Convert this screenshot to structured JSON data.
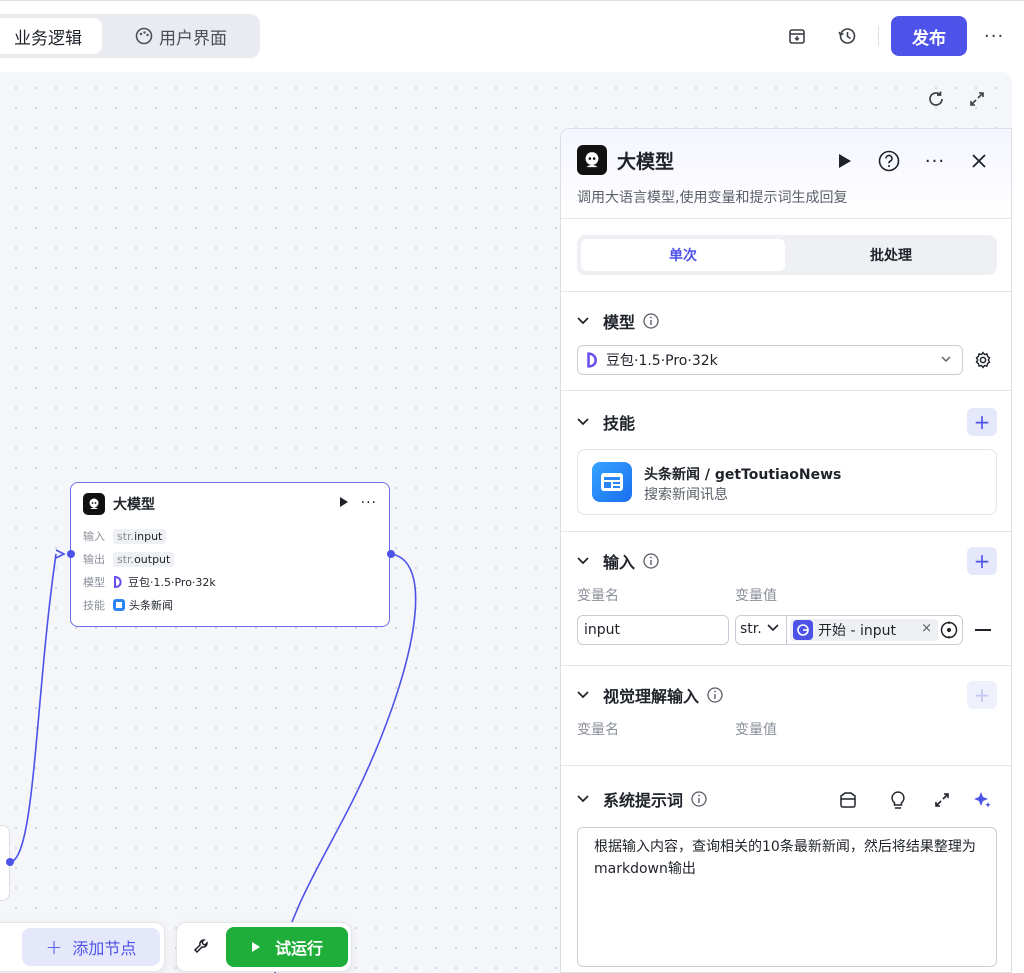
{
  "tabs": [
    {
      "label": "业务逻辑"
    },
    {
      "label": "用户界面"
    }
  ],
  "toolbar": {
    "publish_label": "发布"
  },
  "node": {
    "title": "大模型",
    "rows": [
      {
        "key": "输入",
        "prefix": "str.",
        "value": "input"
      },
      {
        "key": "输出",
        "prefix": "str.",
        "value": "output"
      },
      {
        "key": "模型",
        "value": "豆包·1.5·Pro·32k"
      },
      {
        "key": "技能",
        "value": "头条新闻"
      }
    ]
  },
  "bottom": {
    "add_node_label": "添加节点",
    "trial_label": "试运行"
  },
  "panel": {
    "title": "大模型",
    "description": "调用大语言模型,使用变量和提示词生成回复",
    "segments": [
      "单次",
      "批处理"
    ],
    "model_section": {
      "title": "模型",
      "selected": "豆包·1.5·Pro·32k"
    },
    "skill_section": {
      "title": "技能",
      "skill_name": "头条新闻 / getToutiaoNews",
      "skill_desc": "搜索新闻讯息"
    },
    "input_section": {
      "title": "输入",
      "col_name": "变量名",
      "col_value": "变量值",
      "var_name": "input",
      "var_type": "str.",
      "ref_label": "开始 - input"
    },
    "vision_section": {
      "title": "视觉理解输入",
      "col_name": "变量名",
      "col_value": "变量值"
    },
    "prompt_section": {
      "title": "系统提示词",
      "text": "根据输入内容，查询相关的10条最新新闻，然后将结果整理为markdown输出"
    }
  },
  "colors": {
    "accent": "#4d53e8",
    "run_green": "#1fae3a"
  }
}
